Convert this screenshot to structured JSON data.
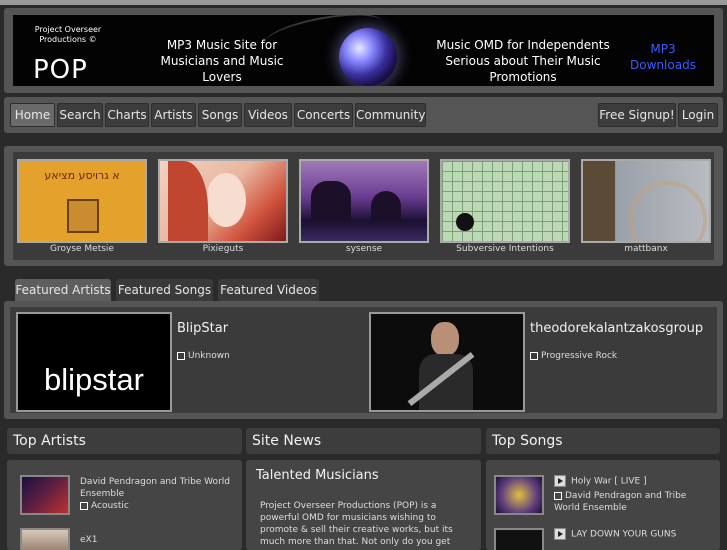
{
  "header": {
    "logo_small": "Project Overseer Productions ©",
    "logo_big": "POP",
    "tagline_left": "MP3 Music Site for Musicians and Music Lovers",
    "tagline_right": "Music OMD for Independents Serious about Their Music Promotions",
    "mp3_link": "MP3 Downloads"
  },
  "nav": {
    "items": [
      "Home",
      "Search",
      "Charts",
      "Artists",
      "Songs",
      "Videos",
      "Concerts",
      "Community"
    ],
    "active": "Home",
    "signup": "Free Signup!",
    "login": "Login"
  },
  "gallery": [
    {
      "caption": "Groyse Metsie",
      "art_text": "א גרויסע מציאע"
    },
    {
      "caption": "Pixieguts"
    },
    {
      "caption": "sysense"
    },
    {
      "caption": "Subversive Intentions"
    },
    {
      "caption": "mattbanx"
    }
  ],
  "featured": {
    "tabs": [
      "Featured Artists",
      "Featured Songs",
      "Featured Videos"
    ],
    "active_tab": "Featured Artists",
    "artists": [
      {
        "name": "BlipStar",
        "image_text": "blipstar",
        "genre": "Unknown"
      },
      {
        "name": "theodorekalantzakosgroup",
        "genre": "Progressive Rock"
      }
    ]
  },
  "top_artists": {
    "title": "Top Artists",
    "items": [
      {
        "name": "David Pendragon and Tribe World Ensemble",
        "genre": "Acoustic"
      },
      {
        "name": "eX1"
      }
    ]
  },
  "site_news": {
    "title": "Site News",
    "headline": "Talented Musicians",
    "body": "Project Overseer Productions (POP) is a powerful OMD for musicians wishing to promote & sell their creative works, but its much more than that. Not only do you get"
  },
  "top_songs": {
    "title": "Top Songs",
    "items": [
      {
        "title": "Holy War [ LIVE ]",
        "artist": "David Pendragon and Tribe World Ensemble"
      },
      {
        "title": "LAY DOWN YOUR GUNS"
      }
    ]
  },
  "colors": {
    "background": "#2a2a2a",
    "panel": "#555555",
    "link_blue": "#3b5cff"
  }
}
